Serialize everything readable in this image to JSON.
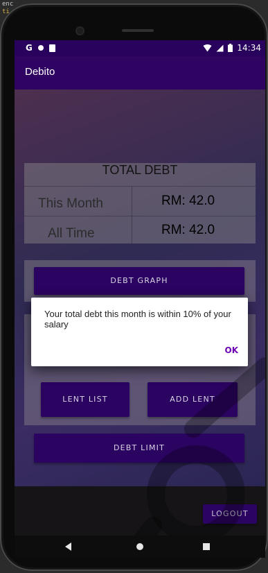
{
  "editor_fragment": {
    "line1": "enc",
    "line2": "ti"
  },
  "status_bar": {
    "time": "14:34",
    "left_icons": [
      "google-icon",
      "record-icon",
      "clipboard-icon"
    ],
    "right_icons": [
      "wifi-icon",
      "signal-icon",
      "battery-icon"
    ]
  },
  "app_bar": {
    "title": "Debito"
  },
  "total_debt": {
    "header": "TOTAL DEBT",
    "rows": [
      {
        "label": "This Month",
        "value": "RM: 42.0"
      },
      {
        "label": "All Time",
        "value": "RM: 42.0"
      }
    ]
  },
  "buttons": {
    "debt_graph": "DEBT GRAPH",
    "lent_list": "LENT LIST",
    "add_lent": "ADD LENT",
    "debt_limit": "DEBT LIMIT",
    "logout": "LOGOUT"
  },
  "dialog": {
    "message": "Your total debt this month is within 10% of your salary",
    "ok": "OK"
  },
  "nav_bar": {
    "icons": [
      "back-icon",
      "home-icon",
      "recents-icon"
    ]
  },
  "colors": {
    "primary": "#2e0361",
    "status_bar": "#29025e",
    "accent": "#6d06b7"
  }
}
